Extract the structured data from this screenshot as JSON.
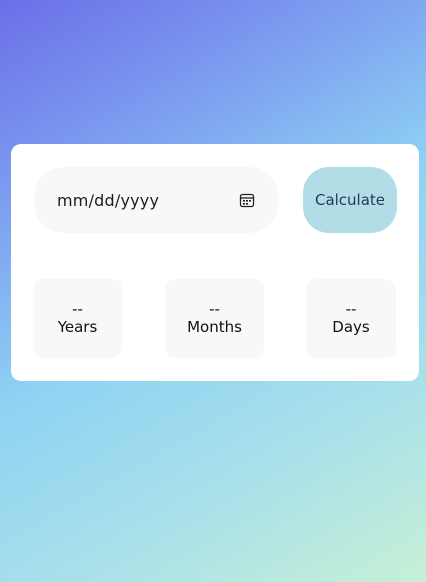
{
  "form": {
    "date_placeholder": "mm/dd/yyyy",
    "calendar_icon": "calendar-icon",
    "calculate_label": "Calculate"
  },
  "results": {
    "years": {
      "value": "--",
      "label": "Years"
    },
    "months": {
      "value": "--",
      "label": "Months"
    },
    "days": {
      "value": "--",
      "label": "Days"
    }
  },
  "colors": {
    "button_bg": "#b3dde6",
    "field_bg": "#f7f9f7",
    "card_bg": "#ffffff"
  }
}
